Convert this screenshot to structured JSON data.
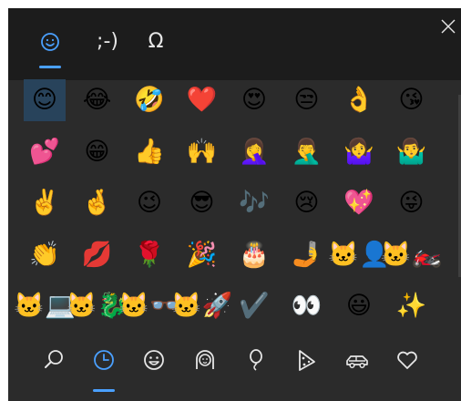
{
  "tabs": [
    {
      "label": "☺",
      "name": "emoji",
      "active": true
    },
    {
      "label": ";-)",
      "name": "kaomoji",
      "active": false
    },
    {
      "label": "Ω",
      "name": "symbols",
      "active": false
    }
  ],
  "close_icon": "close-icon",
  "emoji_grid": [
    [
      "😊",
      "😂",
      "🤣",
      "❤️",
      "😍",
      "😒",
      "👌",
      "😘"
    ],
    [
      "💕",
      "😁",
      "👍",
      "🙌",
      "🤦‍♀️",
      "🤦‍♂️",
      "🤷‍♀️",
      "🤷‍♂️"
    ],
    [
      "✌️",
      "🤞",
      "😉",
      "😎",
      "🎶",
      "😢",
      "💖",
      "😜"
    ],
    [
      "👏",
      "💋",
      "🌹",
      "🎉",
      "🎂",
      "🤳",
      "🐱‍👤",
      "🐱‍🏍"
    ],
    [
      "🐱‍💻",
      "🐱‍🐉",
      "🐱‍👓",
      "🐱‍🚀",
      "✔️",
      "👀",
      "😃",
      "✨"
    ]
  ],
  "selected_emoji": "😊",
  "categories": [
    {
      "name": "search",
      "icon": "search-icon",
      "active": false
    },
    {
      "name": "recent",
      "icon": "clock-icon",
      "active": true
    },
    {
      "name": "smileys",
      "icon": "smiley-icon",
      "active": false
    },
    {
      "name": "people",
      "icon": "person-icon",
      "active": false
    },
    {
      "name": "celebration",
      "icon": "balloon-icon",
      "active": false
    },
    {
      "name": "food",
      "icon": "pizza-icon",
      "active": false
    },
    {
      "name": "travel",
      "icon": "car-icon",
      "active": false
    },
    {
      "name": "symbols",
      "icon": "heart-icon",
      "active": false
    }
  ],
  "colors": {
    "panel_bg": "#2b2b2b",
    "topbar_bg": "#1c1c1c",
    "accent": "#4aa0ff",
    "selected_cell": "#28435b"
  }
}
